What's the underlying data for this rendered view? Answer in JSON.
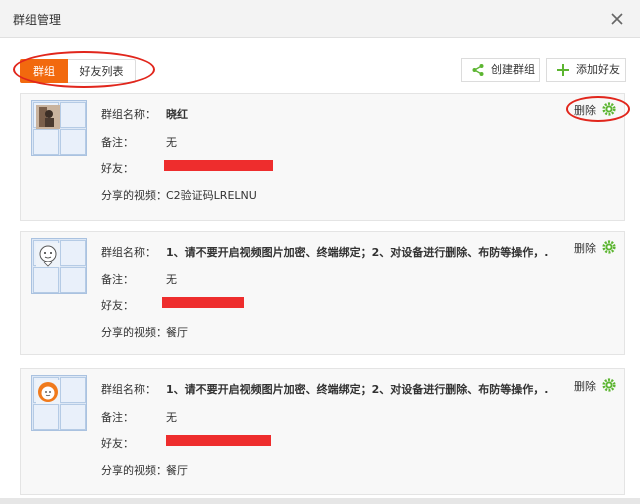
{
  "dialog": {
    "title": "群组管理"
  },
  "tabs": [
    {
      "label": "群组",
      "active": true
    },
    {
      "label": "好友列表",
      "active": false
    }
  ],
  "toolbar": {
    "create_label": "创建群组",
    "add_friend_label": "添加好友"
  },
  "colors": {
    "accent": "#f2690e",
    "annotation_red": "#e1261c",
    "gear_green": "#5cb531",
    "redaction": "#ee2d2d"
  },
  "groups": [
    {
      "name_label": "群组名称：",
      "name": "晓红",
      "remark_label": "备注：",
      "remark": "无",
      "friends_label": "好友：",
      "shared_label": "分享的视频：",
      "shared": "C2验证码LRELNU",
      "delete_label": "删除"
    },
    {
      "name_label": "群组名称：",
      "name": "1、请不要开启视频图片加密、终端绑定；2、对设备进行删除、布防等操作，.",
      "remark_label": "备注：",
      "remark": "无",
      "friends_label": "好友：",
      "shared_label": "分享的视频：",
      "shared": "餐厅",
      "delete_label": "删除"
    },
    {
      "name_label": "群组名称：",
      "name": "1、请不要开启视频图片加密、终端绑定；2、对设备进行删除、布防等操作，.",
      "remark_label": "备注：",
      "remark": "无",
      "friends_label": "好友：",
      "shared_label": "分享的视频：",
      "shared": "餐厅",
      "delete_label": "删除"
    }
  ]
}
